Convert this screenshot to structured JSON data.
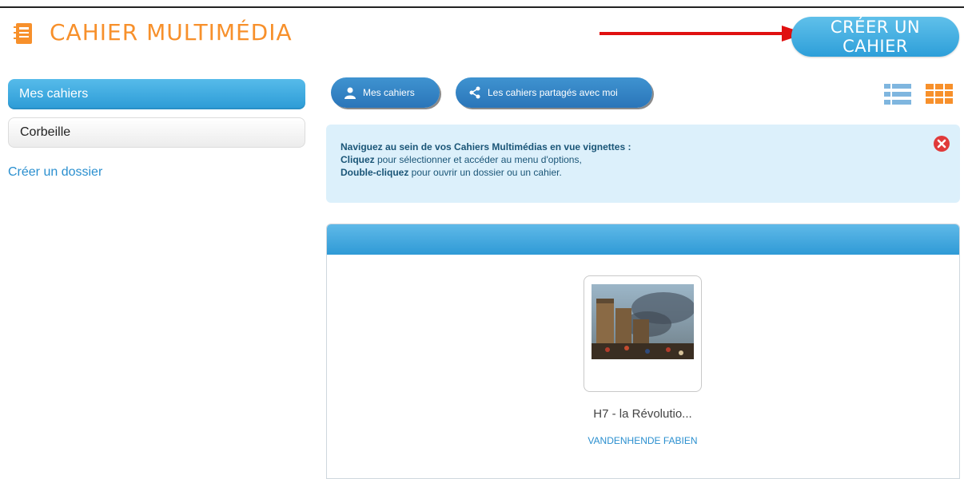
{
  "header": {
    "title": "CAHIER MULTIMÉDIA",
    "create_button": "CRÉER UN CAHIER",
    "logo_icon": "notebook-icon",
    "accent_color": "#f7902b"
  },
  "sidebar": {
    "items": [
      {
        "label": "Mes cahiers",
        "active": true
      },
      {
        "label": "Corbeille",
        "active": false
      }
    ],
    "create_folder": "Créer un dossier"
  },
  "toolbar": {
    "tabs": [
      {
        "label": "Mes cahiers",
        "icon": "user-icon"
      },
      {
        "label": "Les cahiers partagés avec moi",
        "icon": "share-icon"
      }
    ],
    "views": [
      {
        "name": "list-view-icon",
        "active": false
      },
      {
        "name": "grid-view-icon",
        "active": true
      }
    ]
  },
  "info": {
    "line1": "Naviguez au sein de vos Cahiers Multimédias en vue vignettes :",
    "line2_bold": "Cliquez",
    "line2_rest": " pour sélectionner et accéder au menu d'options,",
    "line3_bold": "Double-cliquez",
    "line3_rest": " pour ouvrir un dossier ou un cahier."
  },
  "notebooks": [
    {
      "title": "H7 - la Révolutio...",
      "author": "VANDENHENDE FABIEN"
    }
  ],
  "colors": {
    "primary_blue": "#2d9fd9",
    "info_bg": "#dcf0fb",
    "close_red": "#e03a3a",
    "arrow_red": "#e01010"
  }
}
